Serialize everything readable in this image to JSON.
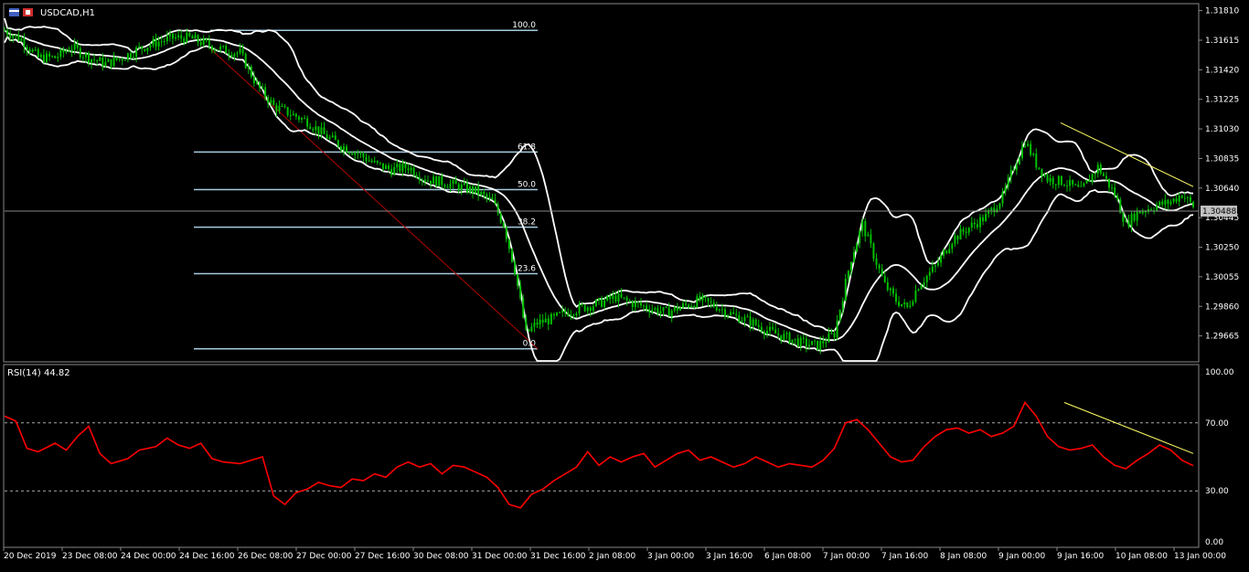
{
  "window": {
    "symbol_title": "USDCAD,H1"
  },
  "colors": {
    "background": "#000000",
    "candle": "#00c000",
    "bands": "#ffffff",
    "fibo": "#a6cae0",
    "trend_red": "#b00000",
    "trend_yellow": "#ffff66",
    "rsi": "#ff0000",
    "text": "#ffffff",
    "current_price_tag": "#c0c0c0"
  },
  "chart_data": [
    {
      "type": "candlestick",
      "title": "USDCAD,H1",
      "ylim": [
        1.295,
        1.3185
      ],
      "price_ticks": [
        "1.31810",
        "1.31615",
        "1.31420",
        "1.31225",
        "1.31030",
        "1.30835",
        "1.30640",
        "1.30445",
        "1.30250",
        "1.30055",
        "1.29860",
        "1.29665"
      ],
      "price_tick_values": [
        1.3181,
        1.31615,
        1.3142,
        1.31225,
        1.3103,
        1.30835,
        1.3064,
        1.30445,
        1.3025,
        1.30055,
        1.2986,
        1.29665
      ],
      "current_price": "1.30488",
      "current_price_value": 1.30488,
      "indicator": "Bollinger Bands",
      "fibonacci": {
        "levels": [
          "100.0",
          "61.8",
          "50.0",
          "38.2",
          "23.6",
          "0.0"
        ],
        "high": 1.3168,
        "low": 1.2958
      },
      "trend_lines": [
        "red descending (fib range)",
        "yellow resistance descending"
      ],
      "close_path": [
        [
          0,
          1.3168
        ],
        [
          6,
          1.3162
        ],
        [
          12,
          1.315
        ],
        [
          18,
          1.315
        ],
        [
          24,
          1.3157
        ],
        [
          30,
          1.315
        ],
        [
          36,
          1.3146
        ],
        [
          42,
          1.315
        ],
        [
          48,
          1.3156
        ],
        [
          54,
          1.316
        ],
        [
          60,
          1.3163
        ],
        [
          66,
          1.3163
        ],
        [
          72,
          1.3159
        ],
        [
          78,
          1.3155
        ],
        [
          84,
          1.3153
        ],
        [
          90,
          1.3132
        ],
        [
          96,
          1.3118
        ],
        [
          102,
          1.3113
        ],
        [
          108,
          1.3108
        ],
        [
          114,
          1.3099
        ],
        [
          120,
          1.3092
        ],
        [
          126,
          1.3087
        ],
        [
          132,
          1.308
        ],
        [
          138,
          1.3076
        ],
        [
          144,
          1.3078
        ],
        [
          150,
          1.307
        ],
        [
          156,
          1.3068
        ],
        [
          162,
          1.3065
        ],
        [
          168,
          1.3062
        ],
        [
          174,
          1.3055
        ],
        [
          178,
          1.304
        ],
        [
          182,
          1.301
        ],
        [
          186,
          1.2968
        ],
        [
          190,
          1.2975
        ],
        [
          196,
          1.2978
        ],
        [
          200,
          1.2982
        ],
        [
          206,
          1.2985
        ],
        [
          212,
          1.2988
        ],
        [
          218,
          1.2992
        ],
        [
          224,
          1.2988
        ],
        [
          230,
          1.2985
        ],
        [
          236,
          1.2982
        ],
        [
          242,
          1.2986
        ],
        [
          248,
          1.299
        ],
        [
          254,
          1.2986
        ],
        [
          260,
          1.298
        ],
        [
          266,
          1.2976
        ],
        [
          272,
          1.297
        ],
        [
          278,
          1.2966
        ],
        [
          284,
          1.2962
        ],
        [
          290,
          1.296
        ],
        [
          296,
          1.2968
        ],
        [
          302,
          1.3018
        ],
        [
          306,
          1.304
        ],
        [
          310,
          1.302
        ],
        [
          314,
          1.3
        ],
        [
          318,
          1.299
        ],
        [
          322,
          1.2985
        ],
        [
          326,
          1.3
        ],
        [
          332,
          1.3012
        ],
        [
          338,
          1.303
        ],
        [
          344,
          1.3038
        ],
        [
          350,
          1.3045
        ],
        [
          356,
          1.3058
        ],
        [
          360,
          1.3078
        ],
        [
          364,
          1.3095
        ],
        [
          368,
          1.308
        ],
        [
          372,
          1.307
        ],
        [
          378,
          1.3068
        ],
        [
          384,
          1.3062
        ],
        [
          390,
          1.3078
        ],
        [
          396,
          1.306
        ],
        [
          400,
          1.304
        ],
        [
          404,
          1.3048
        ],
        [
          410,
          1.3052
        ],
        [
          416,
          1.3055
        ],
        [
          420,
          1.306
        ],
        [
          424,
          1.3052
        ]
      ],
      "x_last_index": 424
    },
    {
      "type": "line",
      "title": "RSI(14) 44.82",
      "ylim": [
        0,
        100
      ],
      "y_ticks": [
        "100.00",
        "70.00",
        "30.00",
        "0.00"
      ],
      "y_tick_values": [
        100,
        70,
        30,
        0
      ],
      "level_lines": [
        70,
        30
      ],
      "series": [
        {
          "values": [
            [
              0,
              74
            ],
            [
              4,
              71
            ],
            [
              8,
              55
            ],
            [
              12,
              53
            ],
            [
              18,
              58
            ],
            [
              22,
              54
            ],
            [
              26,
              62
            ],
            [
              30,
              68
            ],
            [
              34,
              52
            ],
            [
              38,
              46
            ],
            [
              44,
              49
            ],
            [
              48,
              54
            ],
            [
              54,
              56
            ],
            [
              58,
              61
            ],
            [
              62,
              57
            ],
            [
              66,
              55
            ],
            [
              70,
              58
            ],
            [
              74,
              49
            ],
            [
              78,
              47
            ],
            [
              84,
              46
            ],
            [
              88,
              48
            ],
            [
              92,
              50
            ],
            [
              96,
              27
            ],
            [
              100,
              22
            ],
            [
              104,
              29
            ],
            [
              108,
              31
            ],
            [
              112,
              35
            ],
            [
              116,
              33
            ],
            [
              120,
              32
            ],
            [
              124,
              37
            ],
            [
              128,
              36
            ],
            [
              132,
              40
            ],
            [
              136,
              38
            ],
            [
              140,
              44
            ],
            [
              144,
              47
            ],
            [
              148,
              44
            ],
            [
              152,
              46
            ],
            [
              156,
              40
            ],
            [
              160,
              45
            ],
            [
              164,
              44
            ],
            [
              168,
              41
            ],
            [
              172,
              38
            ],
            [
              176,
              32
            ],
            [
              180,
              22
            ],
            [
              184,
              20
            ],
            [
              188,
              28
            ],
            [
              192,
              31
            ],
            [
              196,
              36
            ],
            [
              200,
              40
            ],
            [
              204,
              44
            ],
            [
              208,
              53
            ],
            [
              212,
              45
            ],
            [
              216,
              50
            ],
            [
              220,
              47
            ],
            [
              224,
              50
            ],
            [
              228,
              52
            ],
            [
              232,
              44
            ],
            [
              236,
              48
            ],
            [
              240,
              52
            ],
            [
              244,
              54
            ],
            [
              248,
              48
            ],
            [
              252,
              50
            ],
            [
              256,
              47
            ],
            [
              260,
              44
            ],
            [
              264,
              46
            ],
            [
              268,
              50
            ],
            [
              272,
              47
            ],
            [
              276,
              44
            ],
            [
              280,
              46
            ],
            [
              284,
              45
            ],
            [
              288,
              44
            ],
            [
              292,
              48
            ],
            [
              296,
              55
            ],
            [
              300,
              70
            ],
            [
              304,
              72
            ],
            [
              308,
              66
            ],
            [
              312,
              58
            ],
            [
              316,
              50
            ],
            [
              320,
              47
            ],
            [
              324,
              48
            ],
            [
              328,
              56
            ],
            [
              332,
              62
            ],
            [
              336,
              66
            ],
            [
              340,
              67
            ],
            [
              344,
              64
            ],
            [
              348,
              66
            ],
            [
              352,
              62
            ],
            [
              356,
              64
            ],
            [
              360,
              68
            ],
            [
              364,
              82
            ],
            [
              368,
              74
            ],
            [
              372,
              62
            ],
            [
              376,
              56
            ],
            [
              380,
              54
            ],
            [
              384,
              55
            ],
            [
              388,
              57
            ],
            [
              392,
              50
            ],
            [
              396,
              45
            ],
            [
              400,
              43
            ],
            [
              404,
              48
            ],
            [
              408,
              52
            ],
            [
              412,
              57
            ],
            [
              416,
              54
            ],
            [
              420,
              48
            ],
            [
              424,
              44.82
            ]
          ]
        }
      ],
      "trend_lines": [
        "yellow descending"
      ],
      "x_last_index": 424
    }
  ],
  "time_axis": {
    "labels": [
      "20 Dec 2019",
      "23 Dec 08:00",
      "24 Dec 00:00",
      "24 Dec 16:00",
      "26 Dec 08:00",
      "27 Dec 00:00",
      "27 Dec 16:00",
      "30 Dec 08:00",
      "31 Dec 00:00",
      "31 Dec 16:00",
      "2 Jan 08:00",
      "3 Jan 00:00",
      "3 Jan 16:00",
      "6 Jan 08:00",
      "7 Jan 00:00",
      "7 Jan 16:00",
      "8 Jan 08:00",
      "9 Jan 00:00",
      "9 Jan 16:00",
      "10 Jan 08:00",
      "13 Jan 00:00"
    ]
  }
}
